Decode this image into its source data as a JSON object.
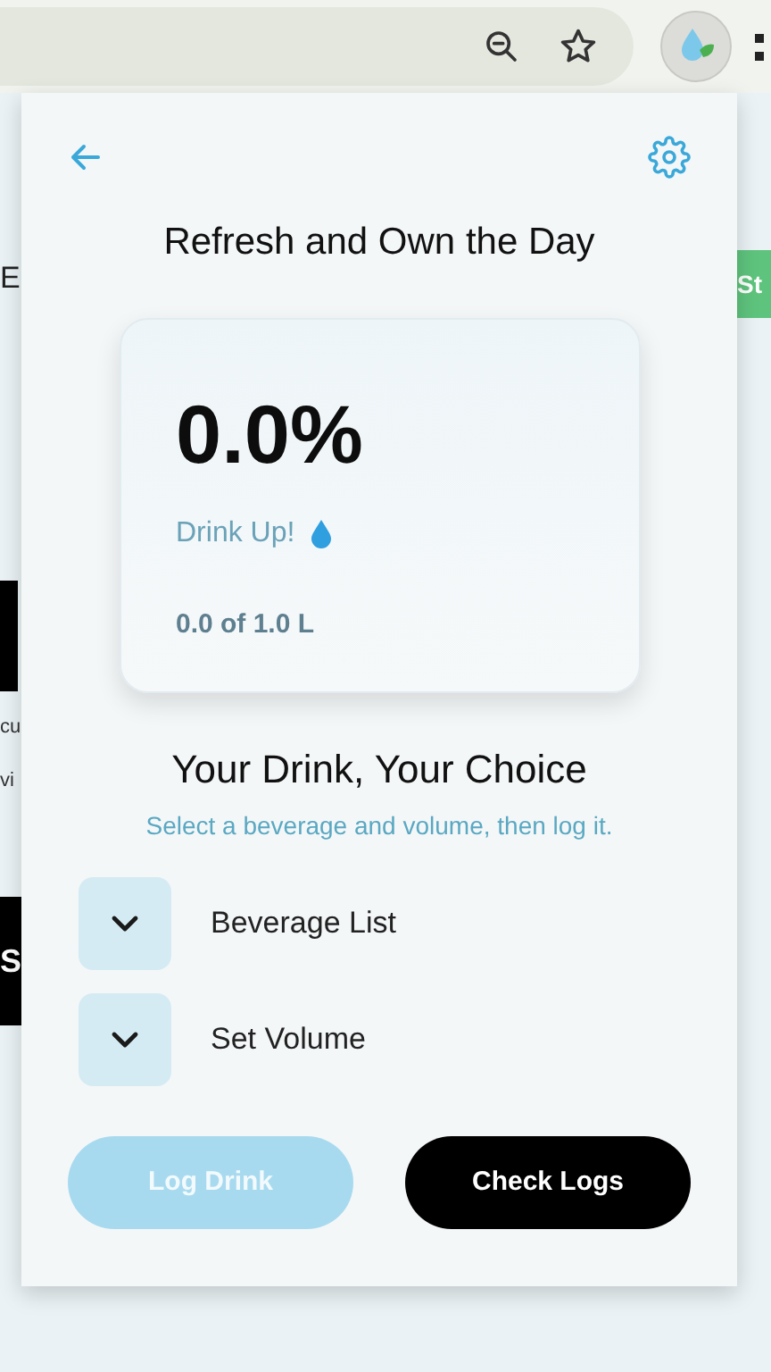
{
  "browser": {
    "page_fragments_left": [
      {
        "kind": "letter",
        "text": "E"
      },
      {
        "kind": "block"
      },
      {
        "kind": "small",
        "text": "cu"
      },
      {
        "kind": "small",
        "text": "vi"
      },
      {
        "kind": "dark",
        "text": "S"
      }
    ],
    "page_fragments_right": [
      {
        "kind": "green",
        "text": "St"
      }
    ]
  },
  "popup": {
    "title": "Refresh and Own the Day",
    "progress": {
      "percent": "0.0%",
      "message": "Drink Up!",
      "amount": "0.0 of 1.0 L"
    },
    "section_title": "Your Drink, Your Choice",
    "section_subtitle": "Select a beverage and volume, then log it.",
    "dropdowns": [
      {
        "label": "Beverage List",
        "expanded": false
      },
      {
        "label": "Set Volume",
        "expanded": false
      }
    ],
    "buttons": [
      {
        "label": "Log Drink",
        "kind": "primary",
        "disabled": true
      },
      {
        "label": "Check Logs",
        "kind": "secondary",
        "disabled": false
      }
    ]
  }
}
